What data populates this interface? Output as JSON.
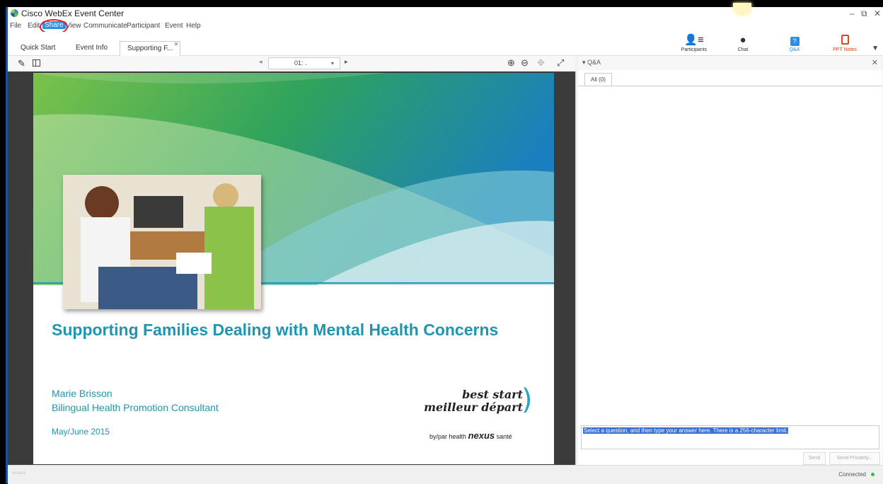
{
  "app": {
    "title": "Cisco WebEx Event Center"
  },
  "menu": [
    "File",
    "Edit",
    "Share",
    "View",
    "Communicate",
    "Participant",
    "Event",
    "Help"
  ],
  "tabs": [
    {
      "label": "Quick Start"
    },
    {
      "label": "Event Info"
    },
    {
      "label": "Supporting F..."
    }
  ],
  "panels": {
    "participants": "Participants",
    "chat": "Chat",
    "qa": "Q&A",
    "ppt_notes": "PPT Notes"
  },
  "viewer": {
    "page_value": "01: .",
    "slide": {
      "title": "Supporting Families Dealing with Mental Health Concerns",
      "presenter": "Marie Brisson",
      "role": "Bilingual Health Promotion Consultant",
      "date": "May/June 2015",
      "brand_line1": "best start",
      "brand_line2": "meilleur départ",
      "brand_by": "by/par health",
      "brand_nexus": "nexus",
      "brand_sante": "santé"
    }
  },
  "qa": {
    "header": "Q&A",
    "tab_all": "All (0)",
    "answer_placeholder": "Select a question, and then type your answer here. There is a 256-character limit.",
    "send": "Send",
    "send_privately": "Send Privately..."
  },
  "status": {
    "connection": "Connected",
    "brand": "cisco"
  },
  "colors": {
    "accent": "#2b8ee8",
    "slide_text": "#1f95b0",
    "highlight": "#3a6fd8"
  }
}
